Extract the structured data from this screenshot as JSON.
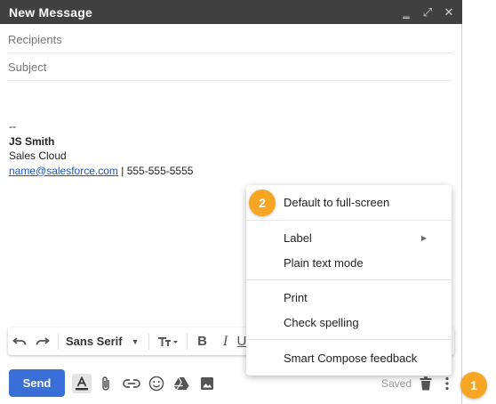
{
  "window": {
    "title": "New Message",
    "minimize_glyph": "‗",
    "expand_glyph": "⤢",
    "close_glyph": "✕"
  },
  "fields": {
    "recipients_placeholder": "Recipients",
    "subject_placeholder": "Subject"
  },
  "signature": {
    "dashes": "--",
    "name": "JS Smith",
    "company": "Sales Cloud",
    "email": "name@salesforce.com",
    "separator": " | ",
    "phone": "555-555-5555"
  },
  "format_bar": {
    "font_name": "Sans Serif",
    "bold": "B",
    "italic": "I",
    "underline": "U",
    "undo_icon": "undo-icon",
    "redo_icon": "redo-icon"
  },
  "bottom_bar": {
    "send_label": "Send",
    "saved_label": "Saved",
    "icons": [
      "text-color-icon",
      "attach-icon",
      "link-icon",
      "emoji-icon",
      "drive-icon",
      "image-icon",
      "trash-icon",
      "more-options-icon"
    ]
  },
  "menu": {
    "items": [
      "Default to full-screen",
      "Label",
      "Plain text mode",
      "Print",
      "Check spelling",
      "Smart Compose feedback"
    ]
  },
  "badges": {
    "first": "1",
    "second": "2"
  },
  "colors": {
    "titlebar": "#404040",
    "send": "#3a6fd8",
    "badge": "#f6a623",
    "link": "#1a56c7"
  }
}
